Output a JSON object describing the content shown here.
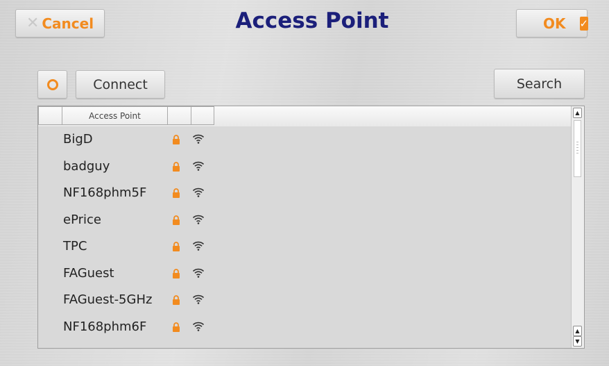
{
  "header": {
    "title": "Access Point",
    "cancel_label": "Cancel",
    "ok_label": "OK"
  },
  "toolbar": {
    "connect_label": "Connect",
    "search_label": "Search"
  },
  "table": {
    "columns": [
      "",
      "Access Point",
      "",
      ""
    ],
    "rows": [
      {
        "name": "BigD",
        "secured": true
      },
      {
        "name": "badguy",
        "secured": true
      },
      {
        "name": "NF168phm5F",
        "secured": true
      },
      {
        "name": "ePrice",
        "secured": true
      },
      {
        "name": "TPC",
        "secured": true
      },
      {
        "name": "FAGuest",
        "secured": true
      },
      {
        "name": "FAGuest-5GHz",
        "secured": true
      },
      {
        "name": "NF168phm6F",
        "secured": true
      }
    ]
  },
  "icons": {
    "cancel": "close-icon",
    "ok": "checkbox-checked-icon",
    "refresh": "refresh-icon",
    "lock": "lock-icon",
    "wifi": "wifi-icon"
  },
  "colors": {
    "accent": "#f28b1f",
    "title": "#1b1f7a"
  }
}
